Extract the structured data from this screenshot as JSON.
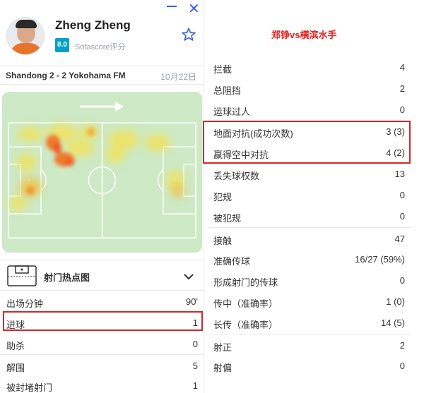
{
  "player": {
    "name": "Zheng Zheng",
    "rating": "8.0",
    "rating_label": "Sofascore评分"
  },
  "match": {
    "name": "Shandong 2 - 2 Yokohama FM",
    "date": "10月22日"
  },
  "shotmap": {
    "label": "射门热点图"
  },
  "left_stats": [
    {
      "label": "出场分钟",
      "value": "90'"
    },
    {
      "label": "进球",
      "value": "1"
    },
    {
      "label": "助杀",
      "value": "0"
    },
    {
      "label": "解围",
      "value": "5"
    },
    {
      "label": "被封堵射门",
      "value": "1"
    }
  ],
  "annotation": {
    "title": "郑铮vs横滨水手"
  },
  "right_stats": [
    {
      "label": "拦截",
      "value": "4"
    },
    {
      "label": "总阻挡",
      "value": "2"
    },
    {
      "label": "运球过人",
      "value": "0"
    },
    {
      "label": "地面对抗(成功次数)",
      "value": "3 (3)"
    },
    {
      "label": "赢得空中对抗",
      "value": "4 (2)"
    },
    {
      "label": "丢失球权数",
      "value": "13"
    },
    {
      "label": "犯规",
      "value": "0"
    },
    {
      "label": "被犯规",
      "value": "0"
    },
    {
      "label": "接触",
      "value": "47"
    },
    {
      "label": "准确传球",
      "value": "16/27 (59%)"
    },
    {
      "label": "形成射门的传球",
      "value": "0"
    },
    {
      "label": "传中（准确率）",
      "value": "1 (0)"
    },
    {
      "label": "长传（准确率）",
      "value": "14 (5)"
    },
    {
      "label": "射正",
      "value": "2"
    },
    {
      "label": "射偏",
      "value": "0"
    }
  ],
  "colors": {
    "accent": "#3b5fd9",
    "rating_bg": "#00a3c4",
    "highlight": "#d4262a",
    "annotation_text": "#e0221c",
    "pitch": "#cde9c5"
  },
  "icons": {
    "minimize": "minimize-icon",
    "close": "close-icon",
    "favorite": "star-icon",
    "shotmap": "goal-map-icon",
    "expand": "chevron-down-icon",
    "direction": "arrow-right-icon"
  }
}
